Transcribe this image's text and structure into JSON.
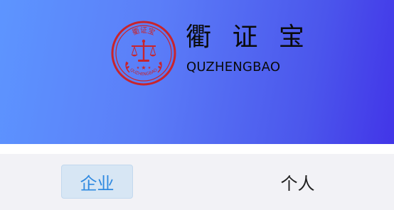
{
  "header": {
    "brand_name_cn": "衢 证 宝",
    "brand_name_en": "QUZHENGBAO",
    "seal_top_text": "衢证宝",
    "seal_bottom_text": "QUZHENGBAO",
    "seal_color": "#c8242c",
    "gradient_colors": [
      "#5d95ff",
      "#4235e8"
    ]
  },
  "tabs": [
    {
      "label": "企业",
      "selected": true
    },
    {
      "label": "个人",
      "selected": false
    }
  ],
  "colors": {
    "active_tab_text": "#2f89e0",
    "active_tab_bg": "#d7e6f4",
    "inactive_tab_text": "#202020"
  }
}
